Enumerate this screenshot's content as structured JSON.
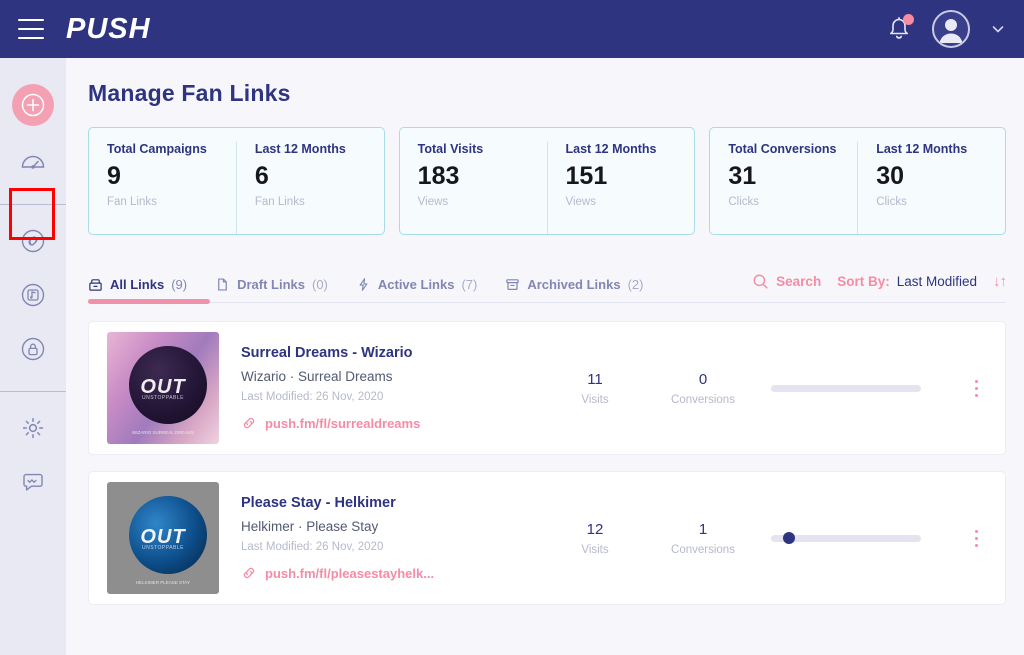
{
  "header": {
    "brand": "PUSH",
    "menu_icon": "hamburger-menu-icon",
    "notification_icon": "bell-icon",
    "avatar_icon": "user-avatar",
    "chevron_icon": "chevron-down-icon"
  },
  "sidebar": {
    "create_button": {
      "icon": "plus-circle-icon",
      "label": ""
    },
    "groups": [
      {
        "items": [
          {
            "name": "dashboard",
            "icon": "speedometer-icon"
          }
        ]
      },
      {
        "items": [
          {
            "name": "fan-links",
            "icon": "link-chain-icon",
            "active": true
          },
          {
            "name": "music",
            "icon": "music-note-circle-icon"
          },
          {
            "name": "locked-content",
            "icon": "lock-circle-icon"
          }
        ]
      },
      {
        "items": [
          {
            "name": "settings",
            "icon": "gear-icon"
          },
          {
            "name": "support-chat",
            "icon": "chat-bubble-icon"
          }
        ]
      }
    ]
  },
  "page": {
    "title": "Manage Fan Links"
  },
  "stats": [
    {
      "left": {
        "label": "Total Campaigns",
        "value": "9",
        "sub": "Fan Links"
      },
      "right": {
        "label": "Last 12 Months",
        "value": "6",
        "sub": "Fan Links"
      }
    },
    {
      "left": {
        "label": "Total Visits",
        "value": "183",
        "sub": "Views"
      },
      "right": {
        "label": "Last 12 Months",
        "value": "151",
        "sub": "Views"
      }
    },
    {
      "left": {
        "label": "Total Conversions",
        "value": "31",
        "sub": "Clicks"
      },
      "right": {
        "label": "Last 12 Months",
        "value": "30",
        "sub": "Clicks"
      }
    }
  ],
  "tabs": [
    {
      "label": "All Links",
      "count": "(9)",
      "icon": "archive-stack-icon",
      "active": true
    },
    {
      "label": "Draft Links",
      "count": "(0)",
      "icon": "document-icon",
      "active": false
    },
    {
      "label": "Active Links",
      "count": "(7)",
      "icon": "lightning-bolt-icon",
      "active": false
    },
    {
      "label": "Archived Links",
      "count": "(2)",
      "icon": "archive-box-icon",
      "active": false
    }
  ],
  "toolbar": {
    "search_label": "Search",
    "search_icon": "magnifier-icon",
    "sort_label": "Sort By:",
    "sort_value": "Last Modified",
    "sort_arrows": "↓↑"
  },
  "links": [
    {
      "title": "Surreal Dreams - Wizario",
      "meta": "Wizario · Surreal Dreams",
      "date": "Last Modified: 26 Nov, 2020",
      "url": "push.fm/fl/surrealdreams",
      "visits": "11",
      "visits_label": "Visits",
      "conversions": "0",
      "conversions_label": "Conversions",
      "progress_percent": 0,
      "art_word": "OUT",
      "art_sub": "UNSTOPPABLE",
      "art_foot": "WIZARIO\nSURREAL DREAMS"
    },
    {
      "title": "Please Stay - Helkimer",
      "meta": "Helkimer · Please Stay",
      "date": "Last Modified: 26 Nov, 2020",
      "url": "push.fm/fl/pleasestayhelk...",
      "visits": "12",
      "visits_label": "Visits",
      "conversions": "1",
      "conversions_label": "Conversions",
      "progress_percent": 8,
      "art_word": "OUT",
      "art_sub": "UNSTOPPABLE",
      "art_foot": "HELKIMER\nPLEASE STAY"
    }
  ],
  "colors": {
    "navy": "#2e3480",
    "pink": "#f58ca4",
    "card_border": "#a9dbe8",
    "sidebar_bg": "#e8e9f3",
    "page_bg": "#f7f7fb",
    "highlight": "#ff0000"
  }
}
